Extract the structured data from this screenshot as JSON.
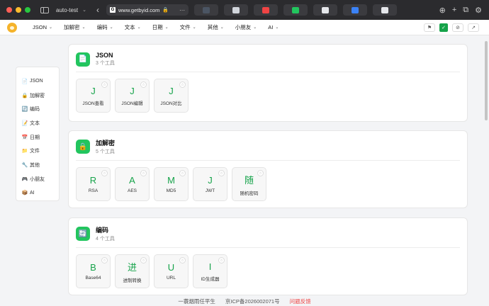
{
  "browser": {
    "tab_group": "auto-test",
    "url": "www.getbyid.com",
    "favicon_letter": "G",
    "tabs": [
      {
        "color": "#4b5563"
      },
      {
        "color": "#d1d5db"
      },
      {
        "color": "#ef4444"
      },
      {
        "color": "#22c55e"
      },
      {
        "color": "#e5e7eb"
      },
      {
        "color": "#3b82f6"
      },
      {
        "color": "#e5e7eb"
      }
    ]
  },
  "nav": {
    "items": [
      "JSON",
      "加解密",
      "编码",
      "文本",
      "日期",
      "文件",
      "其他",
      "小朋友",
      "AI"
    ]
  },
  "sidebar": {
    "items": [
      {
        "label": "JSON",
        "icon": "📄"
      },
      {
        "label": "加解密",
        "icon": "🔒"
      },
      {
        "label": "编码",
        "icon": "🔄"
      },
      {
        "label": "文本",
        "icon": "📝"
      },
      {
        "label": "日期",
        "icon": "📅"
      },
      {
        "label": "文件",
        "icon": "📁"
      },
      {
        "label": "其他",
        "icon": "🔧"
      },
      {
        "label": "小朋友",
        "icon": "🎮"
      },
      {
        "label": "AI",
        "icon": "📦"
      }
    ]
  },
  "sections": [
    {
      "title": "JSON",
      "count": "3 个工具",
      "icon": "📄",
      "tools": [
        {
          "glyph": "J",
          "name": "JSON查看"
        },
        {
          "glyph": "J",
          "name": "JSON编辑"
        },
        {
          "glyph": "J",
          "name": "JSON对比"
        }
      ]
    },
    {
      "title": "加解密",
      "count": "5 个工具",
      "icon": "🔒",
      "tools": [
        {
          "glyph": "R",
          "name": "RSA"
        },
        {
          "glyph": "A",
          "name": "AES"
        },
        {
          "glyph": "M",
          "name": "MD5"
        },
        {
          "glyph": "J",
          "name": "JWT"
        },
        {
          "glyph": "随",
          "name": "随机密码"
        }
      ]
    },
    {
      "title": "编码",
      "count": "4 个工具",
      "icon": "🔄",
      "tools": [
        {
          "glyph": "B",
          "name": "Base64"
        },
        {
          "glyph": "进",
          "name": "进制转换"
        },
        {
          "glyph": "U",
          "name": "URL"
        },
        {
          "glyph": "I",
          "name": "ID生成器"
        }
      ]
    }
  ],
  "footer": {
    "slogan": "一蓑烟雨任平生",
    "icp": "京ICP备2026002071号",
    "feedback": "问题反馈"
  },
  "colors": {
    "accent": "#16a34a",
    "feedback": "#ef4444"
  }
}
